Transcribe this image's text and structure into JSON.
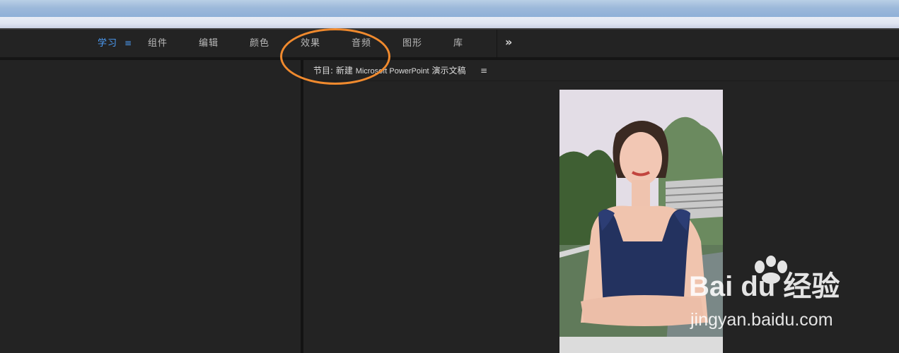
{
  "workspace_tabs": [
    {
      "label": "学习",
      "active": true
    },
    {
      "label": "组件",
      "active": false
    },
    {
      "label": "编辑",
      "active": false
    },
    {
      "label": "颜色",
      "active": false
    },
    {
      "label": "效果",
      "active": false
    },
    {
      "label": "音频",
      "active": false
    },
    {
      "label": "图形",
      "active": false
    },
    {
      "label": "库",
      "active": false
    }
  ],
  "tab_menu_glyph": "≡",
  "overflow_glyph": "»",
  "program_panel": {
    "title_prefix": "节目: 新建 ",
    "title_latin": "Microsoft PowerPoint",
    "title_suffix": " 演示文稿",
    "menu_glyph": "≡"
  },
  "watermark": {
    "brand": "Bai du 经验",
    "url": "jingyan.baidu.com"
  },
  "colors": {
    "active_tab": "#4d9ef8",
    "annotation": "#f08a2e",
    "panel_bg": "#232323"
  },
  "icons": {
    "panel_menu": "hamburger-icon",
    "overflow": "double-chevron-right-icon"
  }
}
